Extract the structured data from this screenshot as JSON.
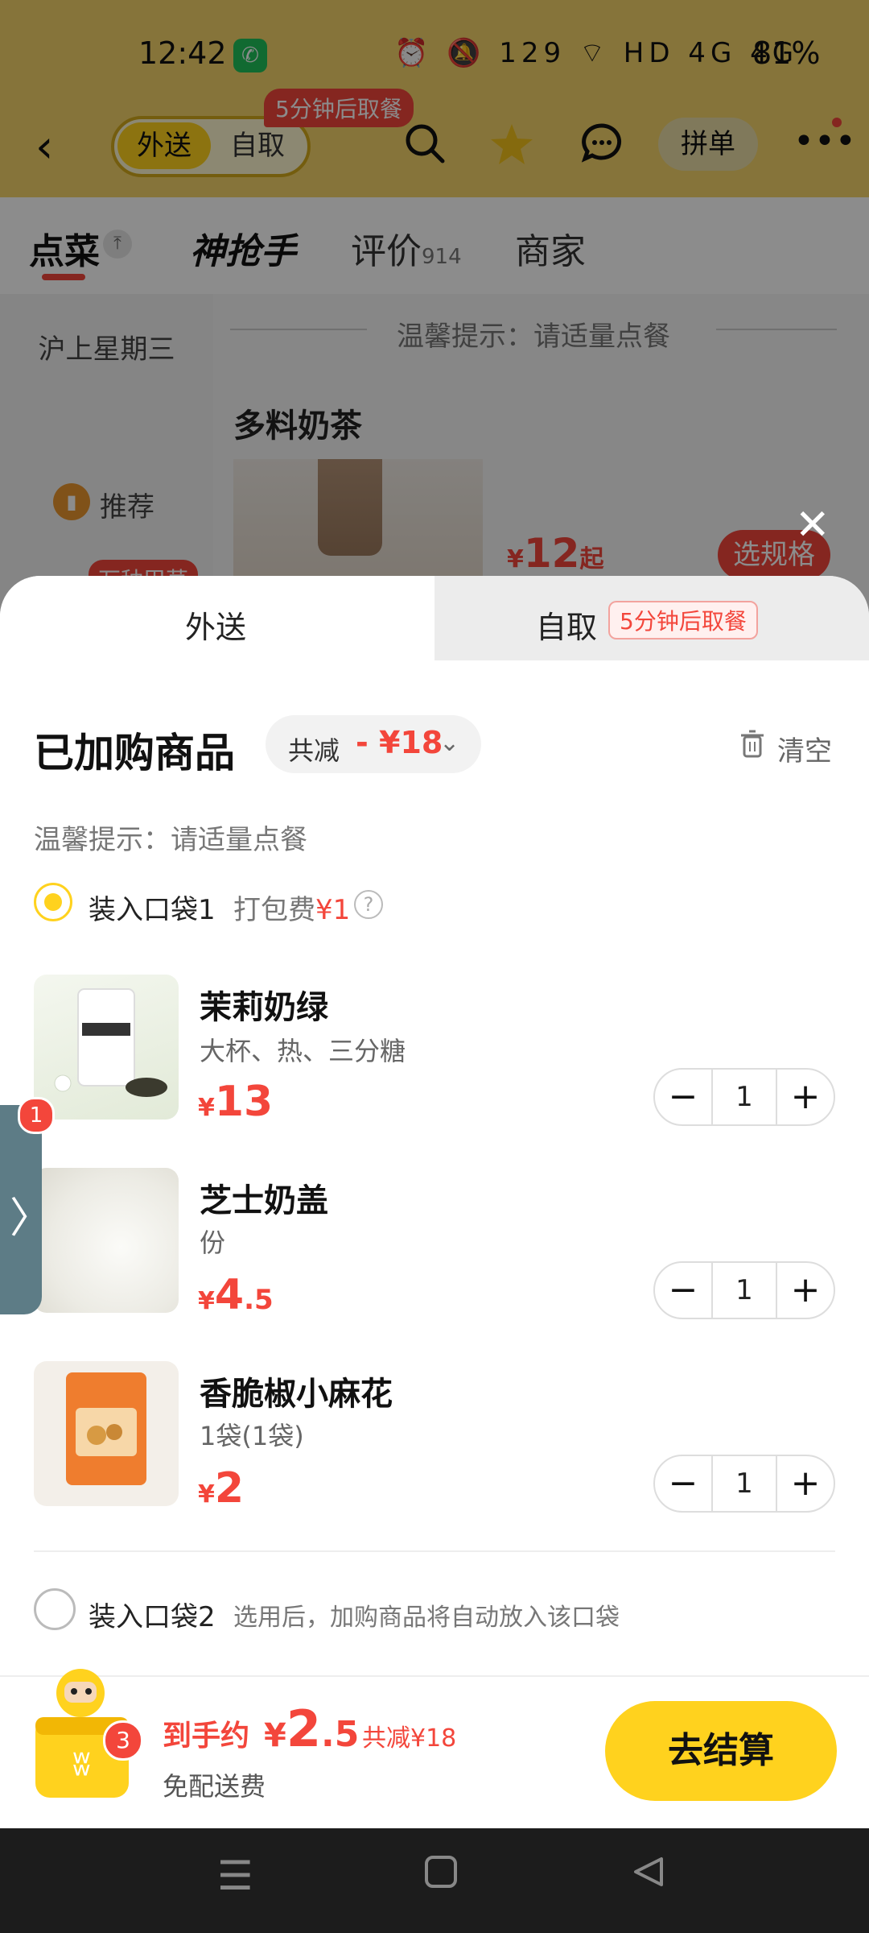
{
  "status_bar": {
    "time": "12:42",
    "call_icon": "phone-icon",
    "indicators": "⏰ 🔕 129 ⌔ HD 4G 4G",
    "battery": "81%"
  },
  "nav": {
    "mode_active": "外送",
    "mode_other": "自取",
    "mode_badge": "5分钟后取餐",
    "group_order": "拼单"
  },
  "tabs": [
    {
      "label": "点菜"
    },
    {
      "label": "神抢手"
    },
    {
      "label": "评价",
      "count": "914"
    },
    {
      "label": "商家"
    }
  ],
  "sidebar": {
    "category": "沪上星期三",
    "recommend": "推荐",
    "tag": "万种甲草"
  },
  "background_menu": {
    "tip": "温馨提示：请适量点餐",
    "section_title": "多料奶茶",
    "price_yen": "¥",
    "price": "12",
    "price_suffix": "起",
    "spec_button": "选规格"
  },
  "sheet": {
    "tab_delivery": "外送",
    "tab_pickup": "自取",
    "pickup_badge": "5分钟后取餐",
    "title": "已加购商品",
    "discount_label": "共减",
    "discount_value": "- ¥18",
    "clear_label": "清空",
    "tip": "温馨提示：请适量点餐",
    "bag1": {
      "label": "装入口袋1",
      "fee_label": "打包费",
      "fee_value": "¥1",
      "help": "?"
    },
    "items": [
      {
        "name": "茉莉奶绿",
        "spec": "大杯、热、三分糖",
        "yen": "¥",
        "price_int": "13",
        "price_dec": "",
        "qty": "1"
      },
      {
        "name": "芝士奶盖",
        "spec": "份",
        "yen": "¥",
        "price_int": "4",
        "price_dec": ".5",
        "qty": "1"
      },
      {
        "name": "香脆椒小麻花",
        "spec": "1袋(1袋)",
        "yen": "¥",
        "price_int": "2",
        "price_dec": "",
        "qty": "1"
      }
    ],
    "bag2": {
      "label": "装入口袋2",
      "desc": "选用后，加购商品将自动放入该口袋"
    }
  },
  "side_float": {
    "badge": "1",
    "arrow": "〉"
  },
  "footer": {
    "cart_badge": "3",
    "total_label": "到手约",
    "total_yen": "¥",
    "total_int": "2",
    "total_dec": ".5",
    "total_save": "共减¥18",
    "delivery_fee": "免配送费",
    "checkout": "去结算"
  },
  "colors": {
    "accent": "#ffd21e",
    "price": "#f3463b"
  }
}
